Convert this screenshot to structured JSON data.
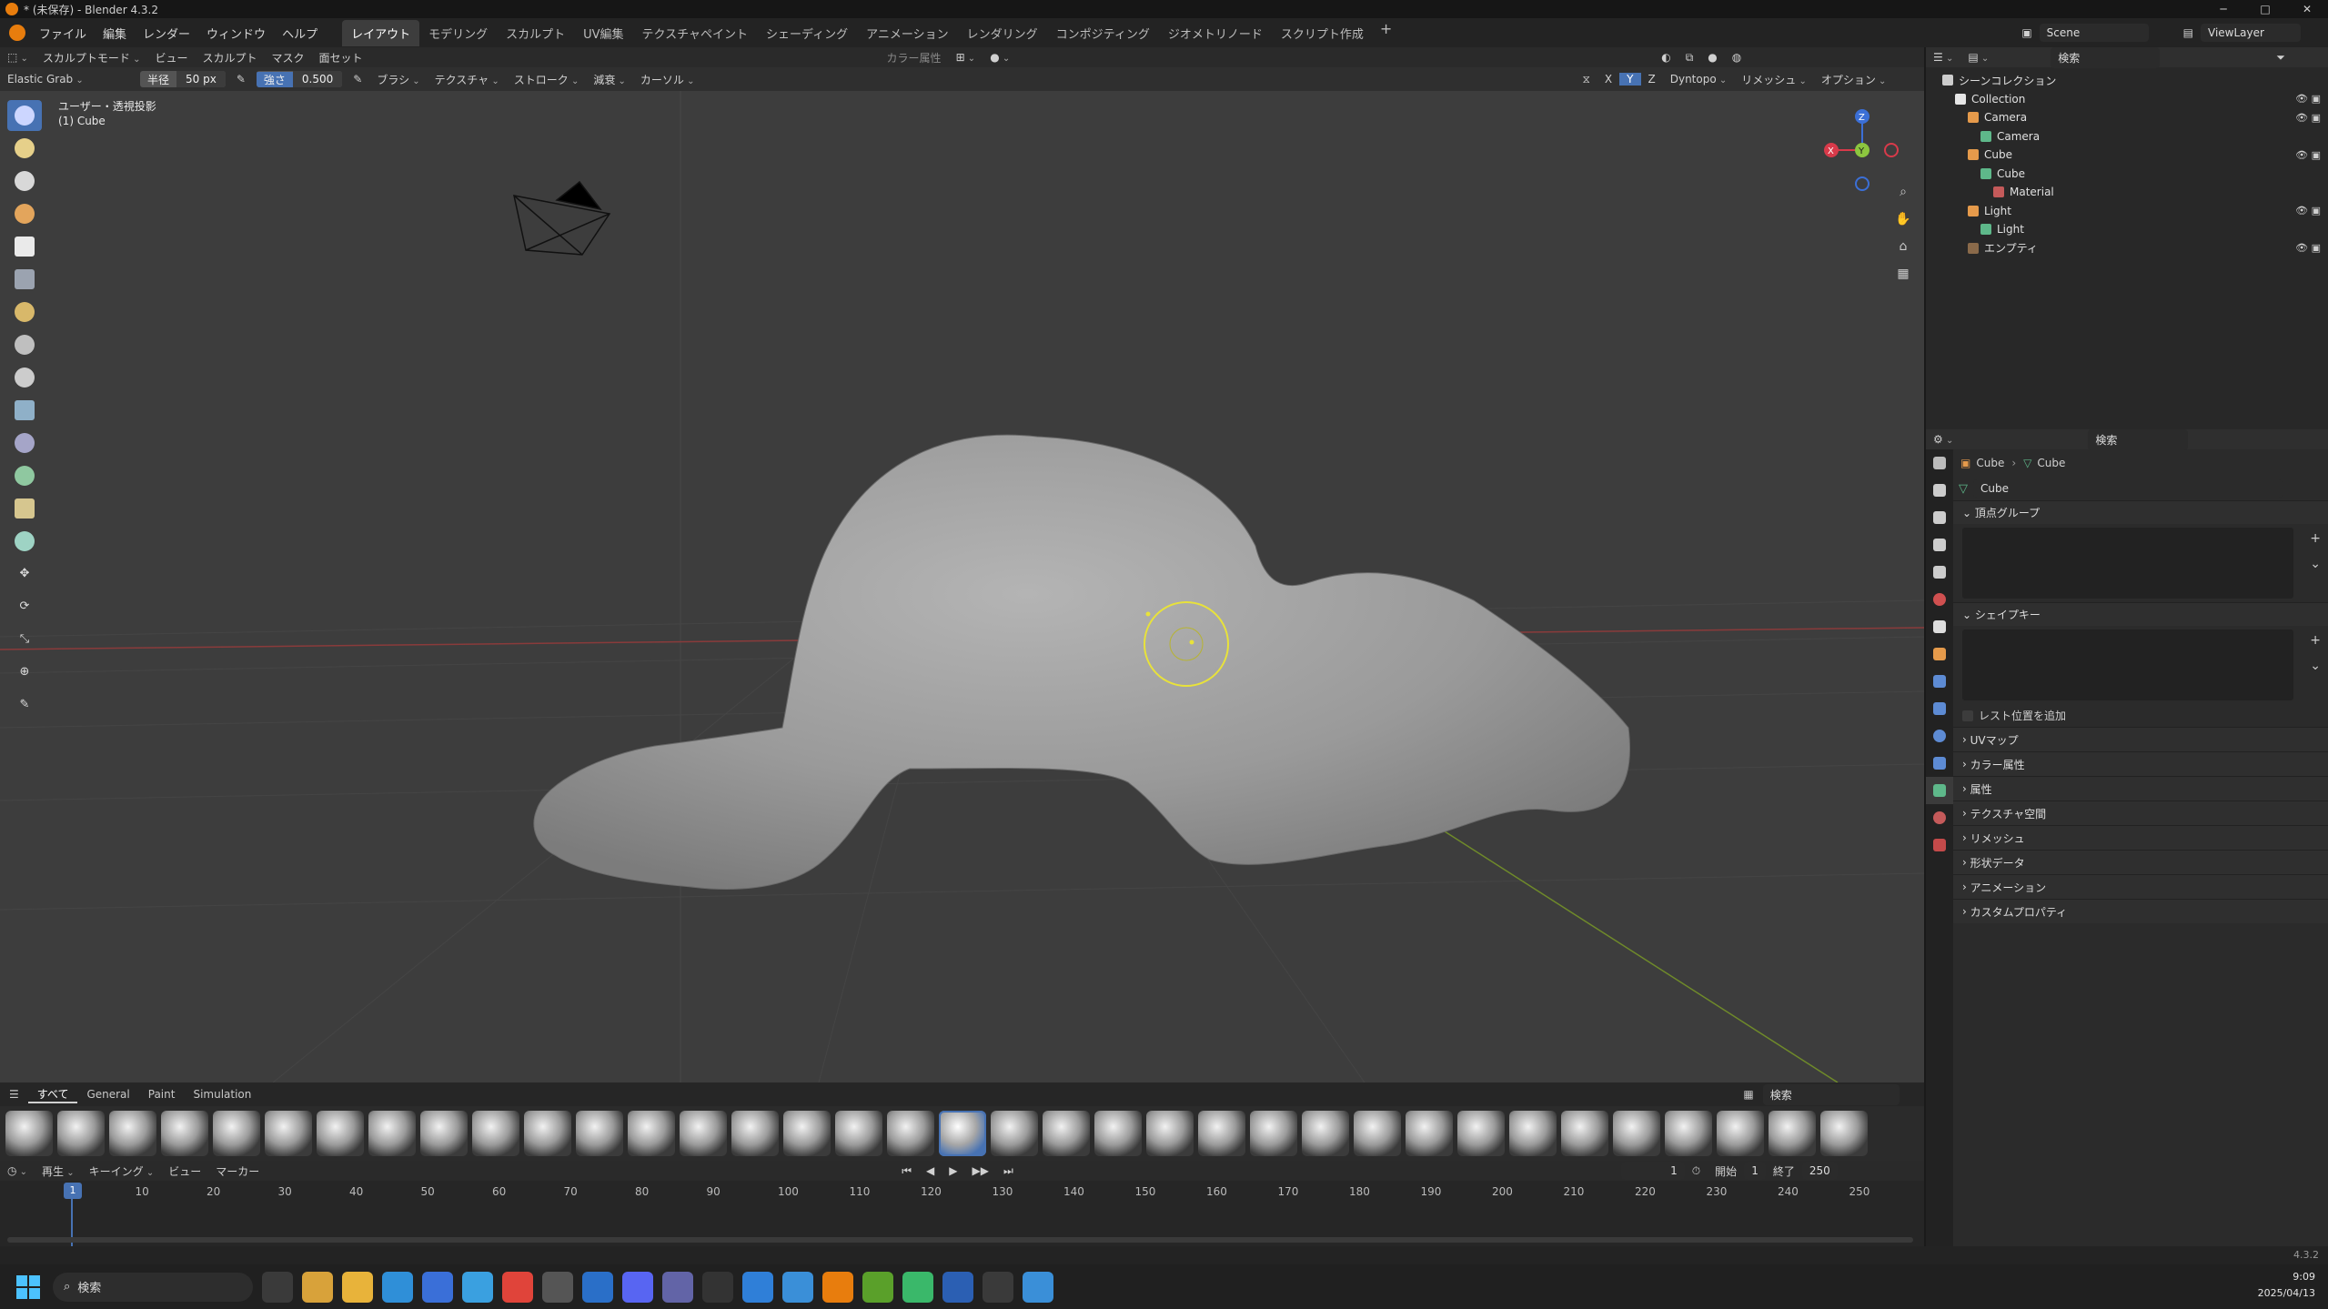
{
  "window": {
    "title": "* (未保存) - Blender 4.3.2",
    "controls": [
      "─",
      "□",
      "✕"
    ]
  },
  "menus": [
    "ファイル",
    "編集",
    "レンダー",
    "ウィンドウ",
    "ヘルプ"
  ],
  "workspaces": [
    "レイアウト",
    "モデリング",
    "スカルプト",
    "UV編集",
    "テクスチャペイント",
    "シェーディング",
    "アニメーション",
    "レンダリング",
    "コンポジティング",
    "ジオメトリノード",
    "スクリプト作成",
    "+"
  ],
  "active_workspace": "レイアウト",
  "scene": {
    "name": "Scene",
    "view_layer": "ViewLayer"
  },
  "viewport_header": {
    "mode": "スカルプトモード",
    "menus": [
      "ビュー",
      "スカルプト",
      "マスク",
      "面セット"
    ],
    "color_attr": "カラー属性",
    "right": [
      "Dyntopo",
      "リメッシュ",
      "オプション"
    ],
    "axes": [
      "X",
      "Y",
      "Z"
    ]
  },
  "tool_settings": {
    "brush": "Elastic Grab",
    "radius_label": "半径",
    "radius_value": "50 px",
    "strength_label": "強さ",
    "strength_value": "0.500",
    "menus": [
      "ブラシ",
      "テクスチャ",
      "ストローク",
      "減衰",
      "カーソル"
    ]
  },
  "viewport": {
    "view_name": "ユーザー・透視投影",
    "object": "(1) Cube"
  },
  "gizmo": {
    "x": "X",
    "y": "Y",
    "z": "Z"
  },
  "asset_shelf": {
    "tabs": [
      "すべて",
      "General",
      "Paint",
      "Simulation"
    ],
    "search": "検索",
    "brush_count": 36,
    "selected_index": 18
  },
  "timeline": {
    "menus": [
      "再生",
      "キーイング",
      "ビュー",
      "マーカー"
    ],
    "current_frame": "1",
    "start_label": "開始",
    "start": "1",
    "end_label": "終了",
    "end": "250",
    "ticks": [
      "10",
      "20",
      "30",
      "40",
      "50",
      "60",
      "70",
      "80",
      "90",
      "100",
      "110",
      "120",
      "130",
      "140",
      "150",
      "160",
      "170",
      "180",
      "190",
      "200",
      "210",
      "220",
      "230",
      "240",
      "250"
    ]
  },
  "outliner": {
    "search": "検索",
    "items": [
      {
        "label": "シーンコレクション",
        "depth": 0,
        "icon_color": "#cccccc"
      },
      {
        "label": "Collection",
        "depth": 1,
        "icon_color": "#e6e6e6"
      },
      {
        "label": "Camera",
        "depth": 2,
        "icon_color": "#e59a4b"
      },
      {
        "label": "Camera",
        "depth": 3,
        "icon_color": "#5eb88a"
      },
      {
        "label": "Cube",
        "depth": 2,
        "icon_color": "#e59a4b"
      },
      {
        "label": "Cube",
        "depth": 3,
        "icon_color": "#5eb88a"
      },
      {
        "label": "Material",
        "depth": 4,
        "icon_color": "#c45a5a"
      },
      {
        "label": "Light",
        "depth": 2,
        "icon_color": "#e59a4b"
      },
      {
        "label": "Light",
        "depth": 3,
        "icon_color": "#5eb88a"
      },
      {
        "label": "エンプティ",
        "depth": 2,
        "icon_color": "#8a6a4a"
      }
    ]
  },
  "properties": {
    "search": "検索",
    "breadcrumb": [
      "Cube",
      "Cube"
    ],
    "datablock": "Cube",
    "panels": [
      "頂点グループ",
      "シェイプキー"
    ],
    "rest_position": "レスト位置を追加",
    "collapsed_panels": [
      "UVマップ",
      "カラー属性",
      "属性",
      "テクスチャ空間",
      "リメッシュ",
      "形状データ",
      "アニメーション",
      "カスタムプロパティ"
    ]
  },
  "status": {
    "version": "4.3.2"
  },
  "taskbar": {
    "search": "検索",
    "time": "9:09",
    "date": "2025/04/13"
  }
}
